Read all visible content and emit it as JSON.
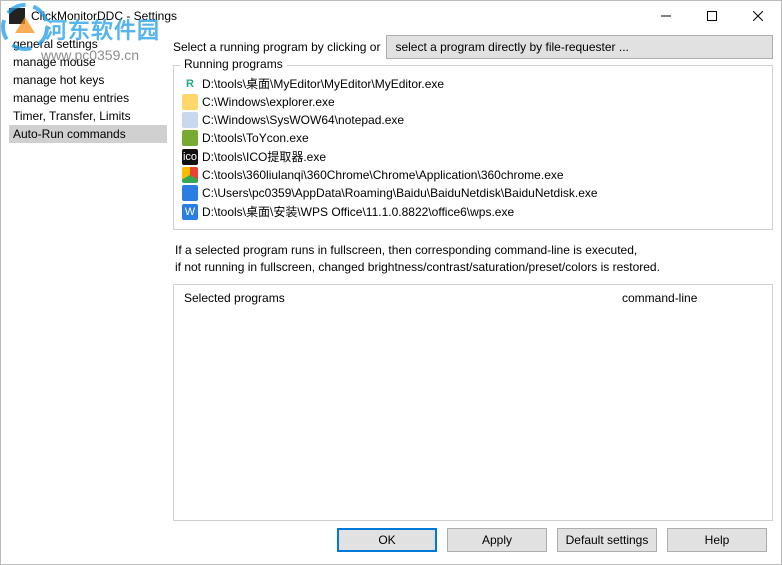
{
  "window": {
    "title": "ClickMonitorDDC - Settings"
  },
  "sidebar": {
    "items": [
      {
        "label": "general settings"
      },
      {
        "label": "manage mouse"
      },
      {
        "label": "manage hot keys"
      },
      {
        "label": "manage menu entries"
      },
      {
        "label": "Timer, Transfer, Limits"
      },
      {
        "label": "Auto-Run commands"
      }
    ],
    "selected_index": 5
  },
  "top": {
    "label": "Select a running program by clicking or",
    "file_requester_btn": "select a program directly by file-requester ..."
  },
  "running": {
    "title": "Running programs",
    "items": [
      {
        "icon": "ic-r",
        "glyph": "R",
        "path": "D:\\tools\\桌面\\MyEditor\\MyEditor\\MyEditor.exe"
      },
      {
        "icon": "ic-folder",
        "glyph": "",
        "path": "C:\\Windows\\explorer.exe"
      },
      {
        "icon": "ic-note",
        "glyph": "",
        "path": "C:\\Windows\\SysWOW64\\notepad.exe"
      },
      {
        "icon": "ic-toy",
        "glyph": "",
        "path": "D:\\tools\\ToYcon.exe"
      },
      {
        "icon": "ic-ico",
        "glyph": "ico",
        "path": "D:\\tools\\ICO提取器.exe"
      },
      {
        "icon": "ic-chrome",
        "glyph": "",
        "path": "C:\\tools\\360liulanqi\\360Chrome\\Chrome\\Application\\360chrome.exe"
      },
      {
        "icon": "ic-baidu",
        "glyph": "",
        "path": "C:\\Users\\pc0359\\AppData\\Roaming\\Baidu\\BaiduNetdisk\\BaiduNetdisk.exe"
      },
      {
        "icon": "ic-wps",
        "glyph": "W",
        "path": "D:\\tools\\桌面\\安装\\WPS Office\\11.1.0.8822\\office6\\wps.exe"
      }
    ]
  },
  "info": {
    "line1": "If a selected program runs in fullscreen, then corresponding command-line is executed,",
    "line2": "if not running in fullscreen, changed brightness/contrast/saturation/preset/colors is restored."
  },
  "selected": {
    "col1": "Selected programs",
    "col2": "command-line"
  },
  "footer": {
    "ok": "OK",
    "apply": "Apply",
    "defaults": "Default settings",
    "help": "Help"
  },
  "watermark": {
    "text": "河东软件园",
    "url": "www.pc0359.cn"
  }
}
